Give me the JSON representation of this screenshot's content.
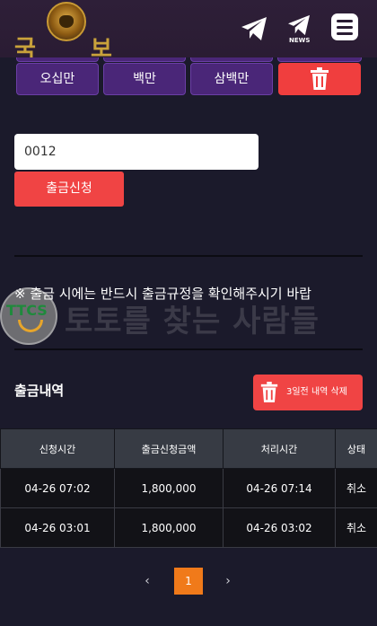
{
  "header": {
    "logo_char_left": "국",
    "logo_char_right": "보",
    "icons": [
      "tiger-emblem",
      "telegram-icon",
      "telegram-news-icon",
      "menu-icon"
    ],
    "news_label": "NEWS"
  },
  "amount_buttons": [
    "오십만",
    "백만",
    "삼백만"
  ],
  "amount_input": {
    "value": "0012"
  },
  "submit_label": "출금신청",
  "notice": "※ 출금 시에는 반드시 출금규정을 확인해주시기 바랍",
  "watermark": {
    "badge": "TTCS",
    "text": "토토를 찾는 사람들"
  },
  "history": {
    "title": "출금내역",
    "delete_old_label": "3일전 내역 삭제"
  },
  "table": {
    "columns": [
      "신청시간",
      "출금신청금액",
      "처리시간",
      "상태"
    ],
    "rows": [
      [
        "04-26 07:02",
        "1,800,000",
        "04-26 07:14",
        "취소"
      ],
      [
        "04-26 03:01",
        "1,800,000",
        "04-26 03:02",
        "취소"
      ]
    ]
  },
  "pagination": {
    "prev": "‹",
    "current": "1",
    "next": "›"
  },
  "colors": {
    "background": "#1b1a2b",
    "header": "#2e1f38",
    "purple_button": "#4a2678",
    "red_button": "#f04444",
    "page_active": "#f07a1a",
    "logo_gold": "#c9a23b"
  }
}
